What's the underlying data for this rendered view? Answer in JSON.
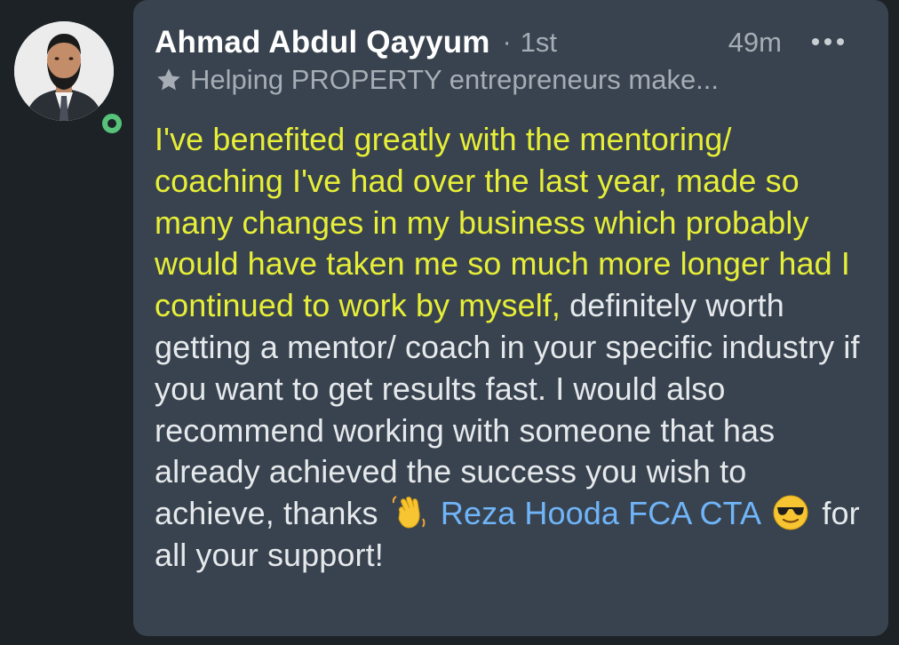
{
  "author": {
    "name": "Ahmad Abdul Qayyum",
    "separator": "·",
    "degree": "1st",
    "headline": "Helping PROPERTY entrepreneurs make...",
    "online": true
  },
  "meta": {
    "time": "49m",
    "more_icon": "more-horizontal-icon"
  },
  "comment": {
    "highlighted_text": "I've benefited greatly with the mentoring/ coaching I've had over the last year, made so many changes in my business which probably would have taken me so much more longer had I continued to work by myself,",
    "body_text": " definitely worth getting a mentor/ coach in your specific industry if you want to get results fast. I would also recommend working with someone that has already achieved the success you wish to achieve, thanks ",
    "emoji_wave": "waving-hand-emoji",
    "mention": "Reza Hooda FCA CTA",
    "emoji_sunglasses": "smiling-face-with-sunglasses-emoji",
    "closing_text": " for all your support!"
  },
  "colors": {
    "background": "#1d2226",
    "card": "#38434f",
    "highlight": "#e7ee37",
    "mention": "#70b5f9",
    "online": "#57c27a"
  }
}
